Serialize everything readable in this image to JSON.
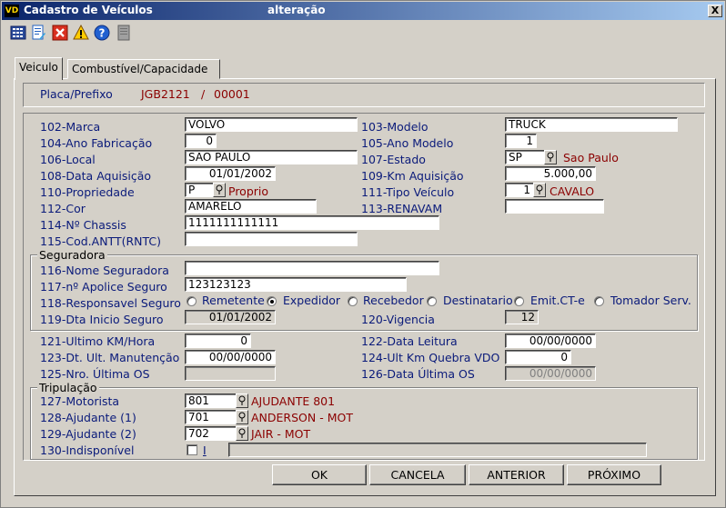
{
  "window": {
    "app_icon": "VD",
    "title": "Cadastro de Veículos",
    "mode": "alteração",
    "close_label": "X"
  },
  "toolbar": {
    "icons": [
      "calculator-icon",
      "edit-document-icon",
      "delete-icon",
      "warning-icon",
      "help-icon",
      "notes-icon"
    ]
  },
  "tabs": [
    {
      "label": "Veiculo"
    },
    {
      "label": "Combustível/Capacidade"
    }
  ],
  "header": {
    "placa_label": "Placa/Prefixo",
    "placa_value": "JGB2121",
    "separator": "/",
    "prefixo_value": "00001"
  },
  "fields": {
    "marca_label": "102-Marca",
    "marca_value": "VOLVO",
    "modelo_label": "103-Modelo",
    "modelo_value": "TRUCK",
    "ano_fab_label": "104-Ano Fabricação",
    "ano_fab_value": "0",
    "ano_mod_label": "105-Ano Modelo",
    "ano_mod_value": "1",
    "local_label": "106-Local",
    "local_value": "SAO PAULO",
    "estado_label": "107-Estado",
    "estado_value": "SP",
    "estado_desc": "Sao Paulo",
    "data_aq_label": "108-Data Aquisição",
    "data_aq_value": "01/01/2002",
    "km_aq_label": "109-Km Aquisição",
    "km_aq_value": "5.000,00",
    "propriedade_label": "110-Propriedade",
    "propriedade_value": "P",
    "propriedade_desc": "Proprio",
    "tipo_label": "111-Tipo Veículo",
    "tipo_value": "1",
    "tipo_desc": "CAVALO",
    "cor_label": "112-Cor",
    "cor_value": "AMARELO",
    "renavam_label": "113-RENAVAM",
    "renavam_value": "",
    "chassis_label": "114-Nº Chassis",
    "chassis_value": "1111111111111",
    "antt_label": "115-Cod.ANTT(RNTC)",
    "antt_value": ""
  },
  "seguradora": {
    "title": "Seguradora",
    "nome_label": "116-Nome Seguradora",
    "nome_value": "",
    "apolice_label": "117-nº Apolice Seguro",
    "apolice_value": "123123123",
    "responsavel_label": "118-Responsavel Seguro",
    "options": [
      "Remetente",
      "Expedidor",
      "Recebedor",
      "Destinatario",
      "Emit.CT-e",
      "Tomador Serv."
    ],
    "selected": "Expedidor",
    "dta_label": "119-Dta Inicio Seguro",
    "dta_value": "01/01/2002",
    "vigencia_label": "120-Vigencia",
    "vigencia_value": "12"
  },
  "manutencao": {
    "km_label": "121-Ultimo KM/Hora",
    "km_value": "0",
    "leitura_label": "122-Data Leitura",
    "leitura_value": "00/00/0000",
    "dt_manut_label": "123-Dt. Ult. Manutenção",
    "dt_manut_value": "00/00/0000",
    "quebra_label": "124-Ult Km Quebra VDO",
    "quebra_value": "0",
    "nro_os_label": "125-Nro. Última OS",
    "nro_os_value": "",
    "data_os_label": "126-Data Última OS",
    "data_os_value": "00/00/0000"
  },
  "tripulacao": {
    "title": "Tripulação",
    "motorista_label": "127-Motorista",
    "motorista_value": "801",
    "motorista_desc": "AJUDANTE 801",
    "ajudante1_label": "128-Ajudante (1)",
    "ajudante1_value": "701",
    "ajudante1_desc": "ANDERSON - MOT",
    "ajudante2_label": "129-Ajudante (2)",
    "ajudante2_value": "702",
    "ajudante2_desc": "JAIR - MOT",
    "indisp_label": "130-Indisponível",
    "indisp_check_label": "I",
    "indisp_value": ""
  },
  "buttons": {
    "ok": "OK",
    "cancela": "CANCELA",
    "anterior": "ANTERIOR",
    "proximo": "PRÓXIMO"
  },
  "colors": {
    "label": "#0a1a7a",
    "value_red": "#8b0000",
    "titlebar_start": "#0a246a",
    "titlebar_end": "#a6caf0"
  }
}
